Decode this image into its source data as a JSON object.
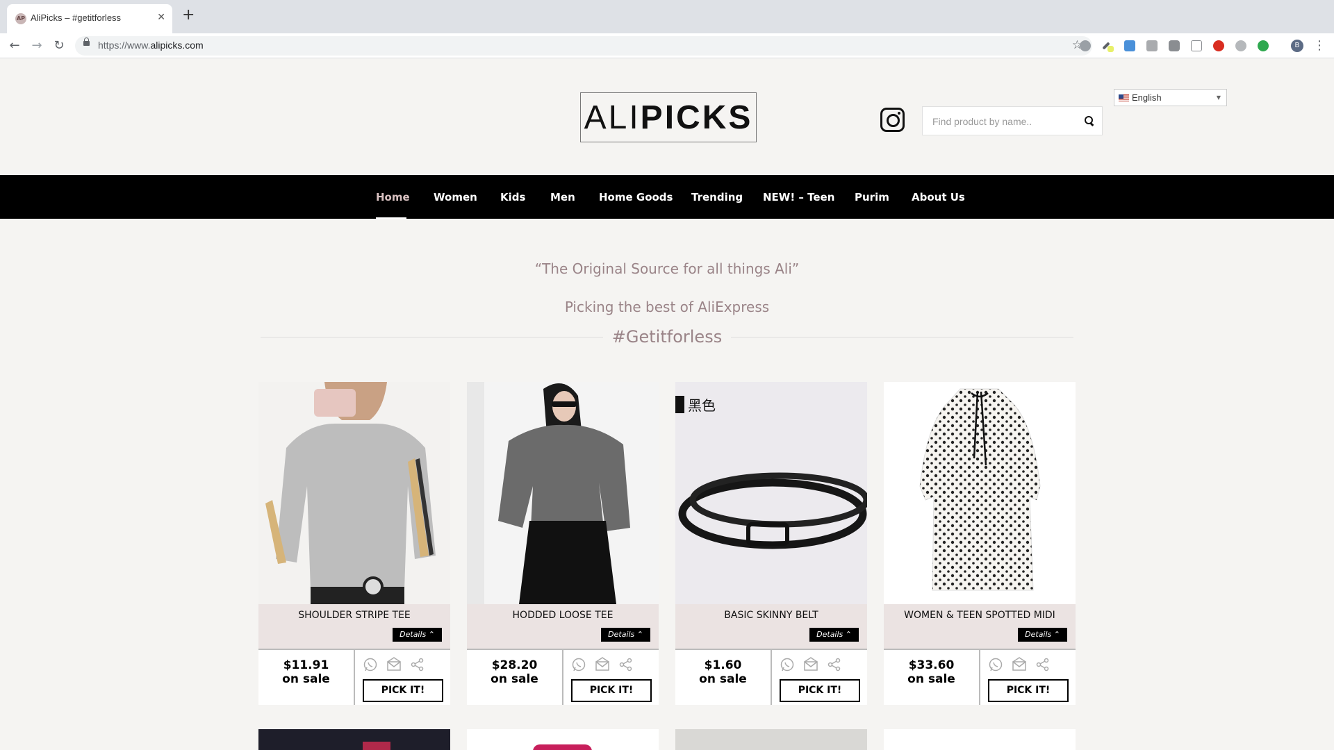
{
  "browser": {
    "tab_title": "AliPicks – #getitforless",
    "favicon_text": "AP",
    "url_prefix": "https://www.",
    "url_domain": "alipicks.com",
    "profile_initial": "B"
  },
  "header": {
    "logo_light": "ALI",
    "logo_bold": "PICKS",
    "search_placeholder": "Find product by name..",
    "language": "English"
  },
  "nav": {
    "items": [
      {
        "label": "Home"
      },
      {
        "label": "Women"
      },
      {
        "label": "Kids"
      },
      {
        "label": "Men"
      },
      {
        "label": "Home Goods"
      },
      {
        "label": "Trending"
      },
      {
        "label": "NEW! – Teen"
      },
      {
        "label": "Purim"
      },
      {
        "label": "About Us"
      }
    ],
    "active": "Home"
  },
  "taglines": {
    "quote": "“The Original Source for all things Ali”",
    "sub": "Picking the best of AliExpress",
    "hashtag": "#Getitforless"
  },
  "products": [
    {
      "name": "SHOULDER STRIPE TEE",
      "price": "$11.91",
      "sale": "on sale",
      "details": "Details",
      "pick": "PICK IT!"
    },
    {
      "name": "HODDED LOOSE TEE",
      "price": "$28.20",
      "sale": "on sale",
      "details": "Details",
      "pick": "PICK IT!"
    },
    {
      "name": "BASIC SKINNY BELT",
      "price": "$1.60",
      "sale": "on sale",
      "details": "Details",
      "pick": "PICK IT!",
      "image_caption": "黑色"
    },
    {
      "name": "WOMEN & TEEN SPOTTED MIDI",
      "price": "$33.60",
      "sale": "on sale",
      "details": "Details",
      "pick": "PICK IT!"
    }
  ],
  "colors": {
    "nav_bg": "#000000",
    "page_bg": "#f5f4f2",
    "tagline": "#9a8488",
    "card_info_bg": "#ebe3e2"
  }
}
